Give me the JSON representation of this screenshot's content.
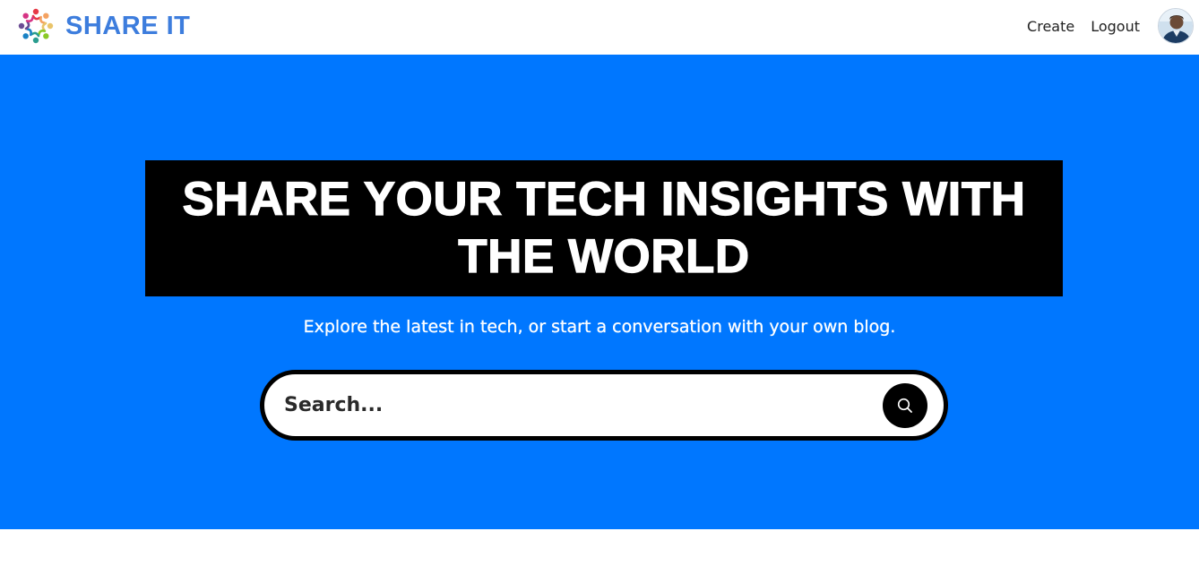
{
  "brand": {
    "name": "SHARE IT",
    "logo_icon": "people-circle-logo-icon",
    "color": "#3d7ddd"
  },
  "nav": {
    "create_label": "Create",
    "logout_label": "Logout",
    "avatar_icon": "user-avatar"
  },
  "hero": {
    "title": "SHARE YOUR TECH INSIGHTS WITH THE WORLD",
    "subtitle": "Explore the latest in tech, or start a conversation with your own blog.",
    "background_color": "#0077ff",
    "title_box_color": "#000000"
  },
  "search": {
    "placeholder": "Search...",
    "value": "",
    "button_icon": "search-icon"
  }
}
